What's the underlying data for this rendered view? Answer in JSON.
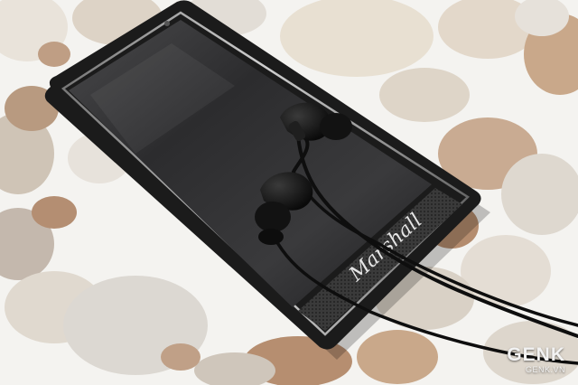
{
  "photo": {
    "subject": "smartphone-with-in-ear-headphones",
    "brand_text": "Marshall",
    "colors": {
      "stone_light": "#ece8e2",
      "stone_beige": "#d8c4a8",
      "stone_rust": "#b88c6c",
      "grout": "#f6f5f2",
      "phone_body": "#1a1a1a",
      "screen": "#2a2a2c",
      "headphones": "#111111"
    }
  },
  "watermark": {
    "logo": "GENK",
    "url": "GENK.VN"
  }
}
